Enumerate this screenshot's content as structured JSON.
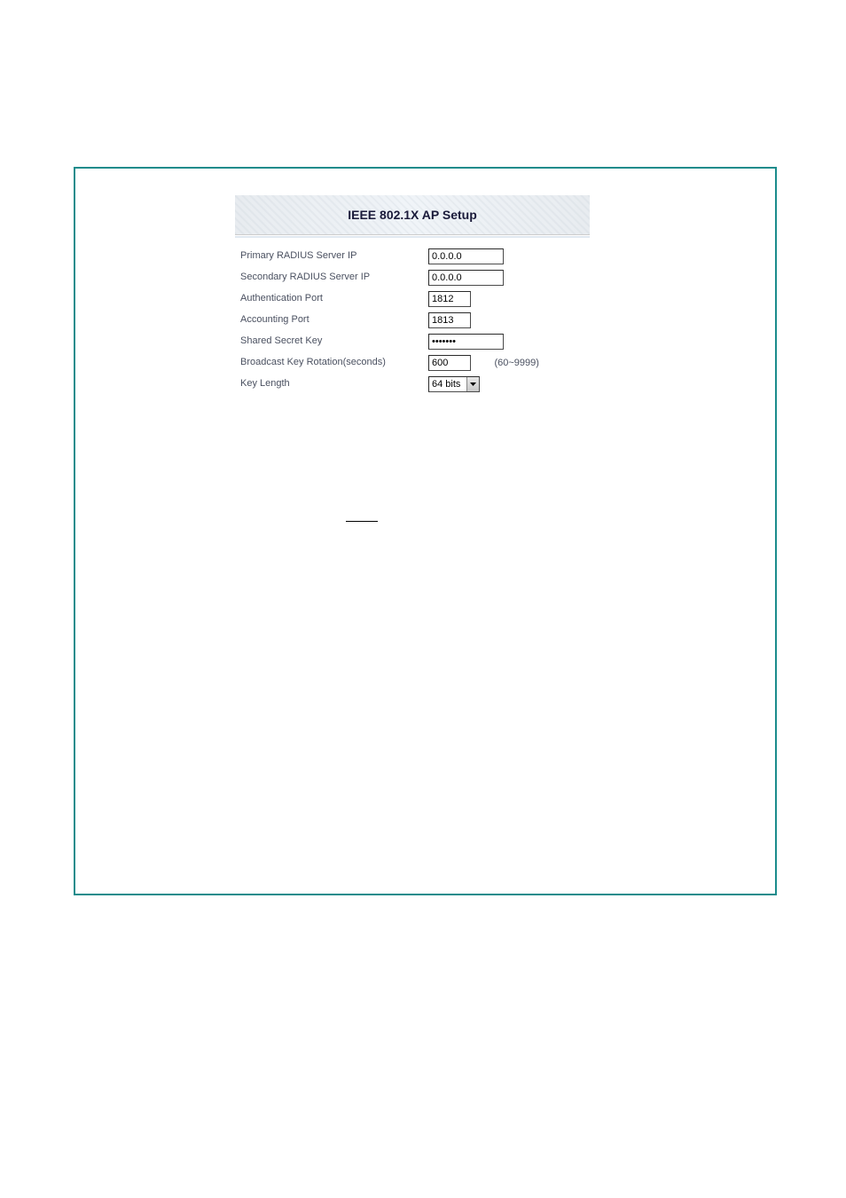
{
  "panel": {
    "title": "IEEE 802.1X AP Setup"
  },
  "form": {
    "primary_radius": {
      "label": "Primary RADIUS Server IP",
      "value": "0.0.0.0"
    },
    "secondary_radius": {
      "label": "Secondary RADIUS Server IP",
      "value": "0.0.0.0"
    },
    "auth_port": {
      "label": "Authentication Port",
      "value": "1812"
    },
    "acct_port": {
      "label": "Accounting Port",
      "value": "1813"
    },
    "shared_secret": {
      "label": "Shared Secret Key",
      "value": "•••••••"
    },
    "broadcast_rotation": {
      "label": "Broadcast Key Rotation(seconds)",
      "value": "600",
      "range_hint": "(60~9999)"
    },
    "key_length": {
      "label": "Key Length",
      "value": "64 bits"
    }
  }
}
